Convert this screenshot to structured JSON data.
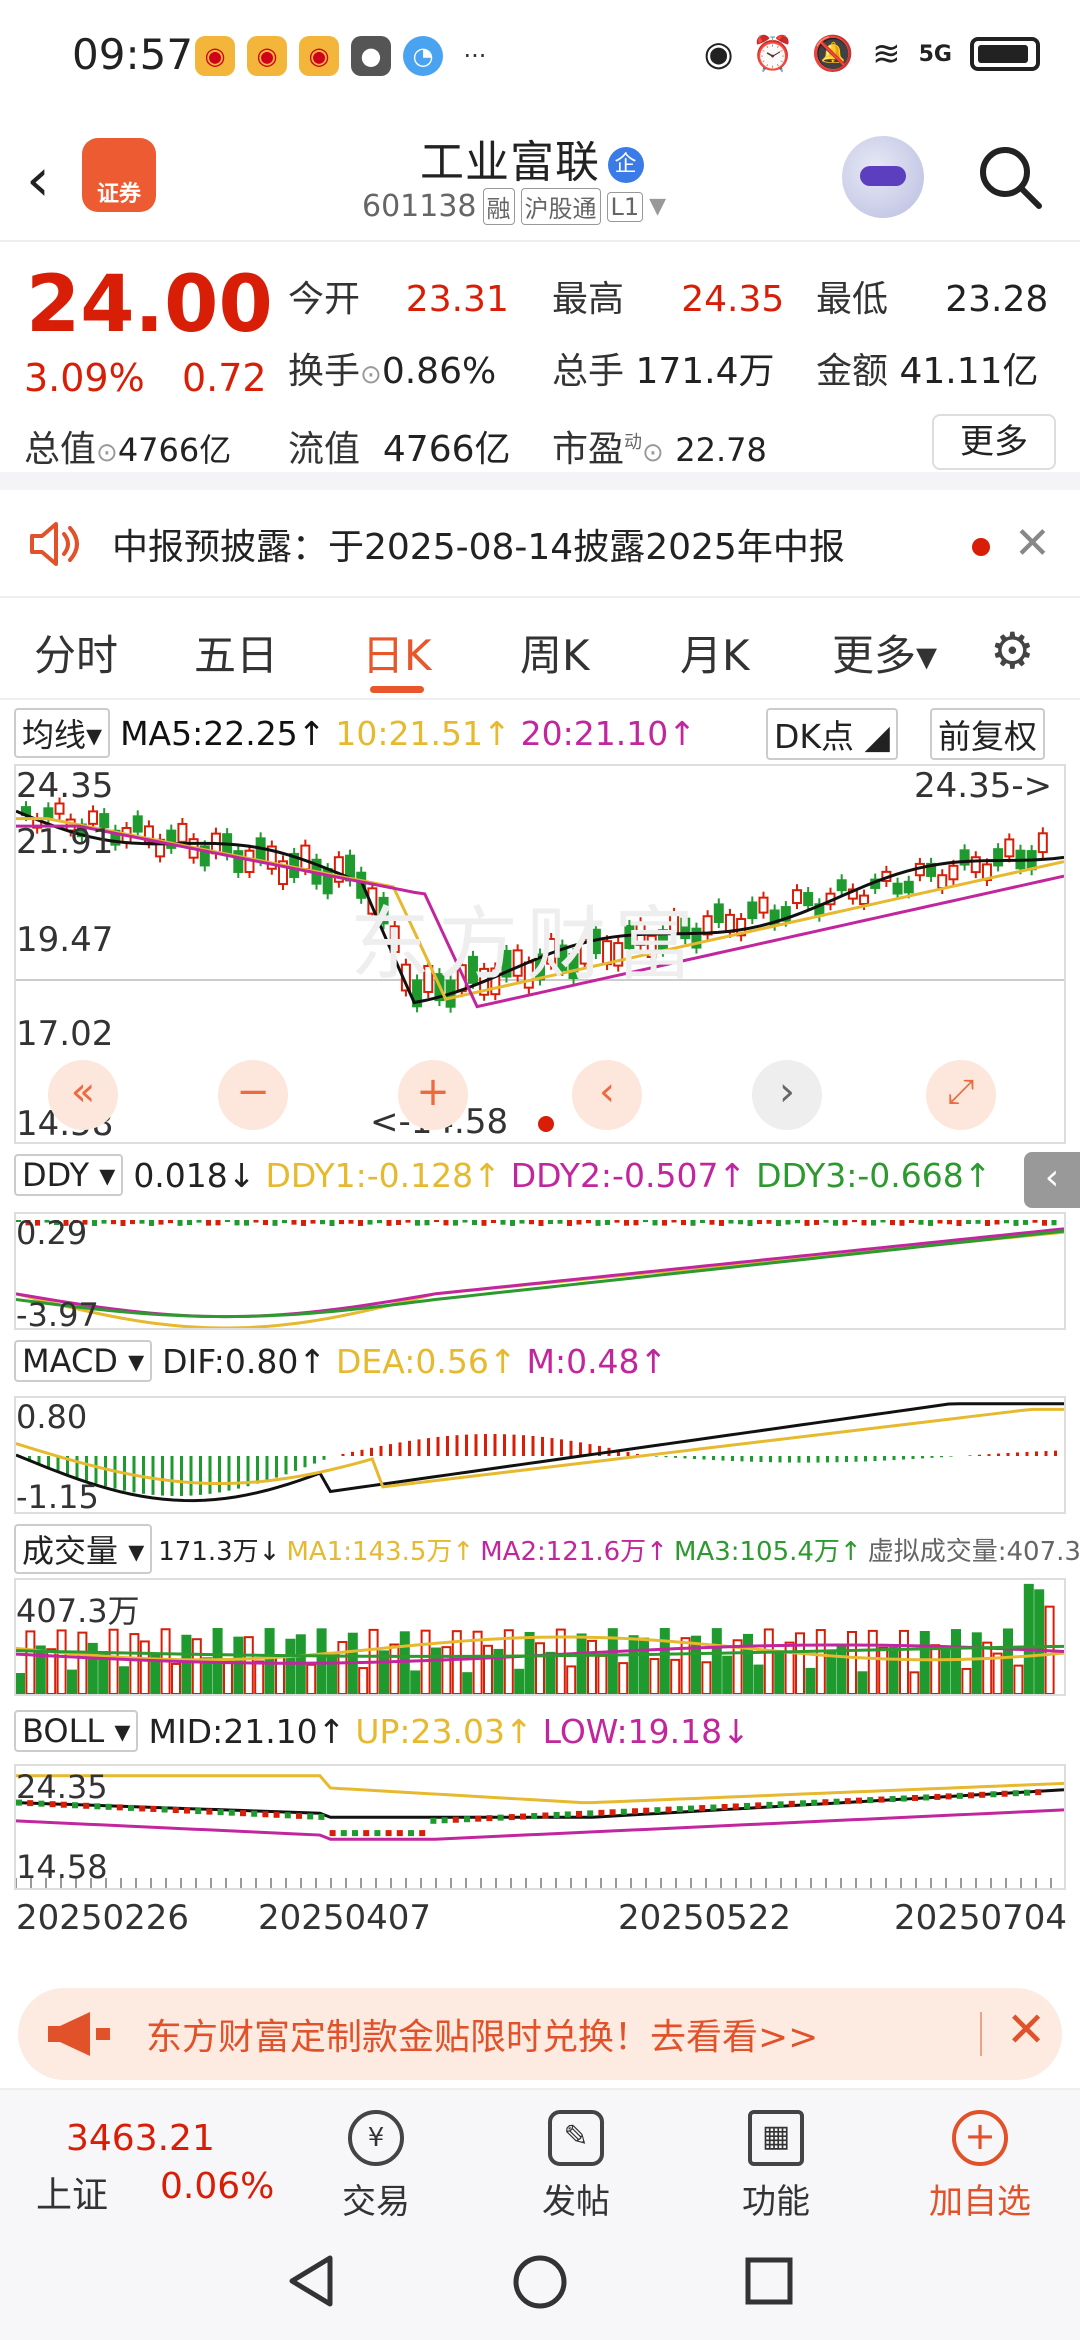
{
  "status": {
    "time": "09:57",
    "network": "5G"
  },
  "header": {
    "logo_text": "证券",
    "title": "工业富联",
    "title_badge": "企",
    "code": "601138",
    "tags": [
      "融",
      "沪股通",
      "L1"
    ]
  },
  "quote": {
    "price": "24.00",
    "pct": "3.09%",
    "change": "0.72",
    "open_label": "今开",
    "open": "23.31",
    "high_label": "最高",
    "high": "24.35",
    "low_label": "最低",
    "low": "23.28",
    "turnover_label": "换手",
    "turnover": "0.86%",
    "volume_label": "总手",
    "volume": "171.4万",
    "amount_label": "金额",
    "amount": "41.11亿",
    "mcap_label": "总值",
    "mcap": "4766亿",
    "float_label": "流值",
    "float": "4766亿",
    "pe_label": "市盈",
    "pe_sup": "动",
    "pe": "22.78",
    "more_label": "更多"
  },
  "notice": {
    "text": "中报预披露：于2025-08-14披露2025年中报"
  },
  "tabs": [
    "分时",
    "五日",
    "日K",
    "周K",
    "月K",
    "更多▾"
  ],
  "active_tab": "日K",
  "ma": {
    "selector": "均线",
    "ma5": "MA5:22.25↑",
    "ma10": "10:21.51↑",
    "ma20": "20:21.10↑",
    "dk": "DK点",
    "adjust": "前复权"
  },
  "kline": {
    "y_labels": [
      "24.35",
      "21.91",
      "19.47",
      "17.02",
      "14.58"
    ],
    "high_annot": "24.35->",
    "low_annot": "<-14.58",
    "watermark": "东方财富"
  },
  "ddy": {
    "selector": "DDY",
    "value": "0.018↓",
    "ddy1": "DDY1:-0.128↑",
    "ddy2": "DDY2:-0.507↑",
    "ddy3": "DDY3:-0.668↑",
    "y_top": "0.29",
    "y_bot": "-3.97"
  },
  "macd": {
    "selector": "MACD",
    "dif": "DIF:0.80↑",
    "dea": "DEA:0.56↑",
    "m": "M:0.48↑",
    "y_top": "0.80",
    "y_bot": "-1.15"
  },
  "vol": {
    "selector": "成交量",
    "value": "171.3万↓",
    "ma1": "MA1:143.5万↑",
    "ma2": "MA2:121.6万↑",
    "ma3": "MA3:105.4万↑",
    "virtual": "虚拟成交量:407.3万",
    "y_top": "407.3万"
  },
  "boll": {
    "selector": "BOLL",
    "mid": "MID:21.10↑",
    "up": "UP:23.03↑",
    "low": "LOW:19.18↓",
    "y_top": "24.35",
    "y_bot": "14.58"
  },
  "dates": [
    "20250226",
    "20250407",
    "20250522",
    "20250704"
  ],
  "promo": {
    "text": "东方财富定制款金贴限时兑换！去看看>>"
  },
  "bottom": {
    "index_value": "3463.21",
    "index_name": "上证",
    "index_pct": "0.06%",
    "trade": "交易",
    "post": "发帖",
    "func": "功能",
    "add": "加自选"
  },
  "colors": {
    "up": "#d81e06",
    "down": "#1e9a2e",
    "ma5": "#111111",
    "ma10": "#e6b92f",
    "ma20": "#c2269e",
    "accent": "#e8562a"
  }
}
